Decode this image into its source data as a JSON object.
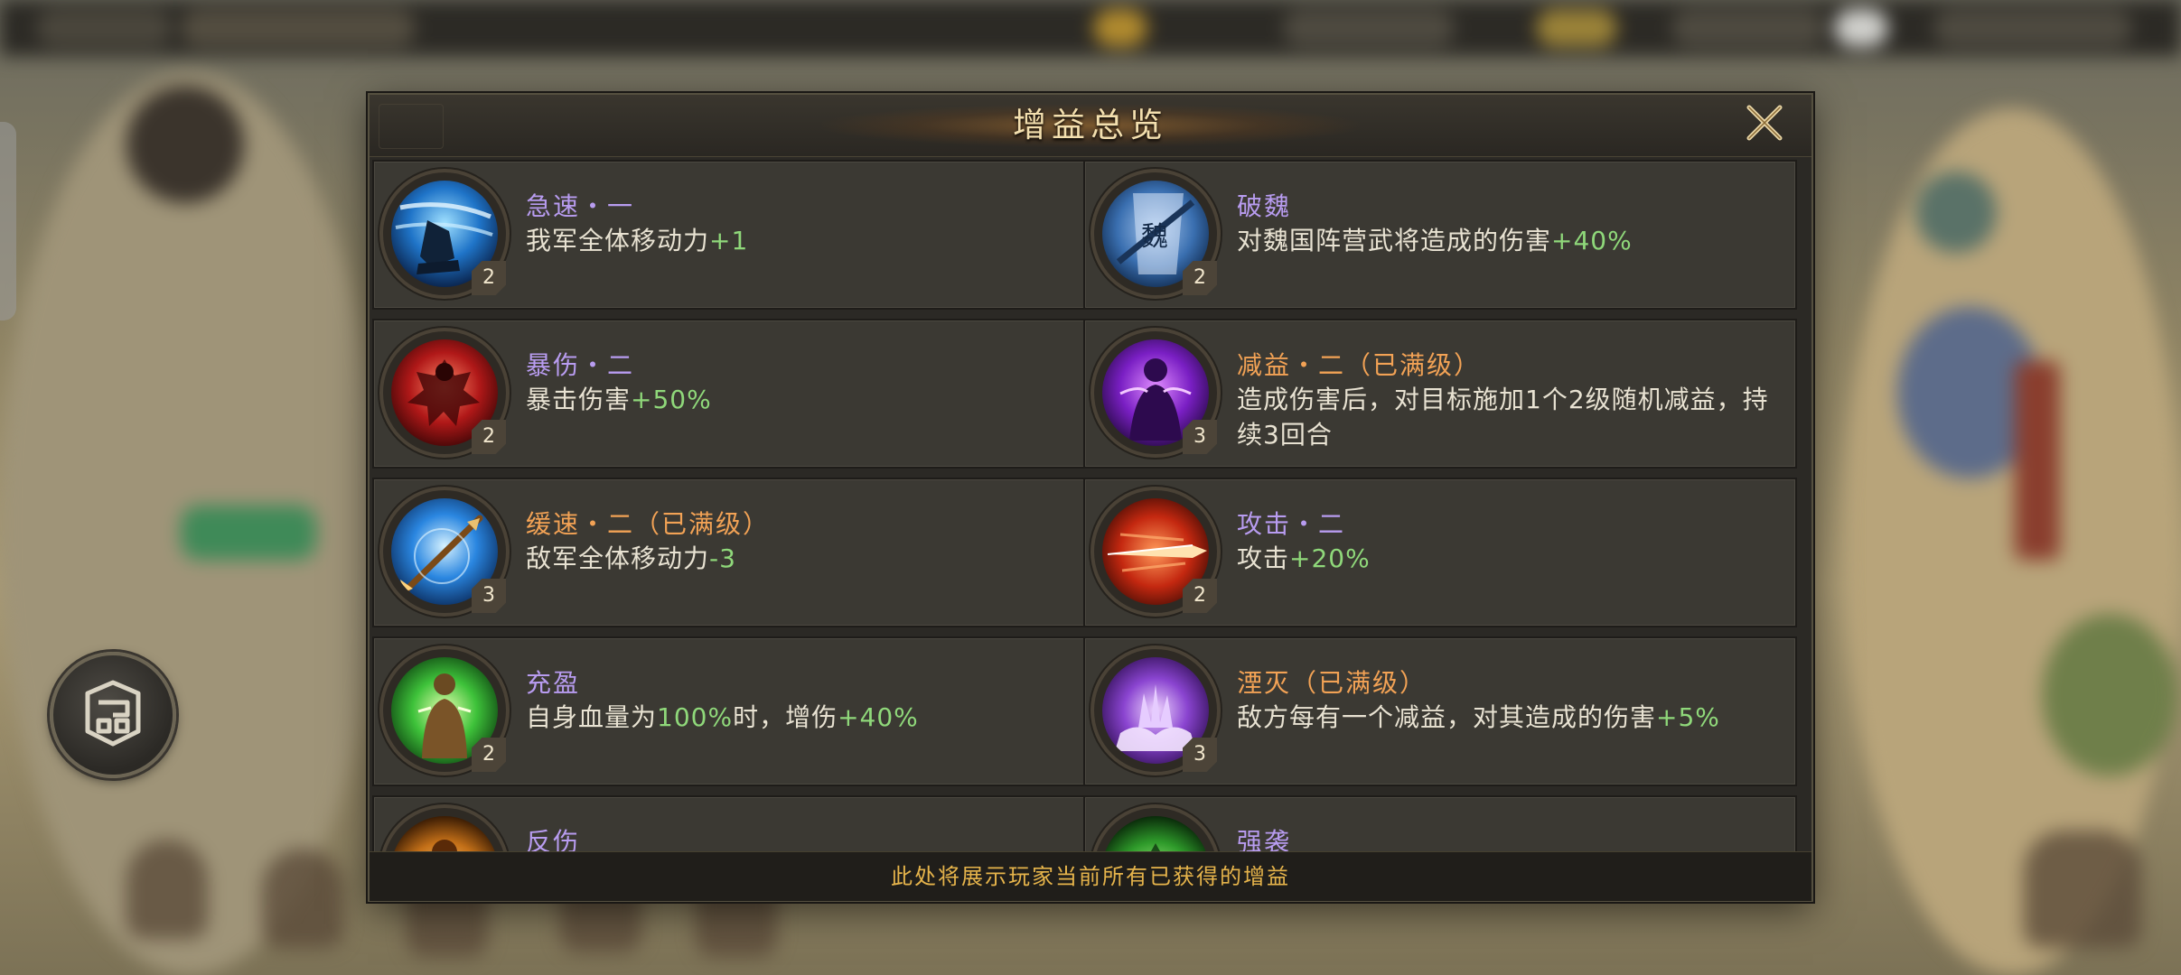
{
  "dialog": {
    "title": "增益总览",
    "footer_note": "此处将展示玩家当前所有已获得的增益"
  },
  "colors": {
    "name_normal": "#b89cf0",
    "name_maxed": "#f2a255",
    "value_highlight": "#8fd87a",
    "footer_text": "#e6b44b"
  },
  "buffs": [
    {
      "name": "急速・一",
      "maxed": false,
      "level": "2",
      "icon": "sprint-foot-icon",
      "desc": [
        {
          "t": "我军全体移动力"
        },
        {
          "t": "+1",
          "hl": true
        }
      ]
    },
    {
      "name": "破魏",
      "maxed": false,
      "level": "2",
      "icon": "wei-banner-icon",
      "desc": [
        {
          "t": "对魏国阵营武将造成的伤害"
        },
        {
          "t": "+40%",
          "hl": true
        }
      ]
    },
    {
      "name": "暴伤・二",
      "maxed": false,
      "level": "2",
      "icon": "crit-burst-icon",
      "desc": [
        {
          "t": "暴击伤害"
        },
        {
          "t": "+50%",
          "hl": true
        }
      ]
    },
    {
      "name": "减益・二（已满级）",
      "maxed": true,
      "level": "3",
      "icon": "debuff-figure-icon",
      "desc": [
        {
          "t": "造成伤害后，对目标施加1个2级随机减益，持续3回合"
        }
      ]
    },
    {
      "name": "缓速・二（已满级）",
      "maxed": true,
      "level": "3",
      "icon": "slow-arrow-icon",
      "desc": [
        {
          "t": "敌军全体移动力"
        },
        {
          "t": "-3",
          "hl": true
        }
      ]
    },
    {
      "name": "攻击・二",
      "maxed": false,
      "level": "2",
      "icon": "attack-blade-icon",
      "desc": [
        {
          "t": "攻击"
        },
        {
          "t": "+20%",
          "hl": true
        }
      ]
    },
    {
      "name": "充盈",
      "maxed": false,
      "level": "2",
      "icon": "full-health-icon",
      "desc": [
        {
          "t": "自身血量为"
        },
        {
          "t": "100%",
          "hl": true
        },
        {
          "t": "时，增伤"
        },
        {
          "t": "+40%",
          "hl": true
        }
      ]
    },
    {
      "name": "湮灭（已满级）",
      "maxed": true,
      "level": "3",
      "icon": "annihilate-splash-icon",
      "desc": [
        {
          "t": "敌方每有一个减益，对其造成的伤害"
        },
        {
          "t": "+5%",
          "hl": true
        }
      ]
    },
    {
      "name": "反伤",
      "maxed": false,
      "level": "",
      "icon": "reflect-damage-icon",
      "desc": []
    },
    {
      "name": "强袭",
      "maxed": false,
      "level": "",
      "icon": "assault-icon",
      "desc": []
    }
  ]
}
